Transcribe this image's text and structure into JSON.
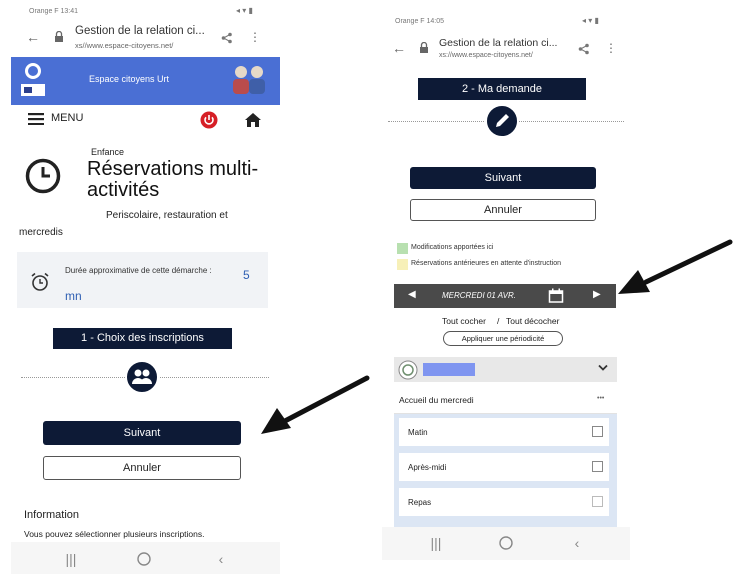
{
  "left": {
    "status_left": "Orange F 13:41",
    "status_right": "",
    "url_title": "Gestion de la relation ci...",
    "url_text": "xs//www.espace-citoyens.net/",
    "portal_name": "Espace citoyens Urt",
    "menu_label": "MENU",
    "category": "Enfance",
    "title_line1": "Réservations multi-",
    "title_line2": "activités",
    "subtitle_line1": "Periscolaire, restauration et",
    "subtitle_line2": "mercredis",
    "duration_label": "Durée approximative de cette démarche :",
    "duration_value": "5",
    "duration_unit": "mn",
    "step_label": "1 - Choix des inscriptions",
    "next_button": "Suivant",
    "cancel_button": "Annuler",
    "info_title": "Information",
    "info_text": "Vous pouvez sélectionner plusieurs inscriptions."
  },
  "right": {
    "status_left": "Orange F 14:05",
    "url_title": "Gestion de la relation ci...",
    "url_text": "xs://www.espace-citoyens.net/",
    "step_label": "2 - Ma demande",
    "next_button": "Suivant",
    "cancel_button": "Annuler",
    "legend_green": "Modifications apportées ici",
    "legend_yellow": "Réservations antérieures en attente d'instruction",
    "date_label": "MERCREDI 01 AVR.",
    "check_all": "Tout cocher",
    "separator": "/",
    "uncheck_all": "Tout décocher",
    "periodicity_button": "Appliquer une périodicité",
    "activity_title": "Accueil du mercredi",
    "activity_more": "•••",
    "slots": [
      "Matin",
      "Après-midi",
      "Repas"
    ]
  },
  "colors": {
    "navy": "#0d1a36",
    "header_blue": "#4a6fd4",
    "power_red": "#d61f26",
    "date_bar": "#4a4a4a",
    "legend_green": "#b8e0b0",
    "legend_yellow": "#f7f0b8",
    "slot_area_bg": "#dce6f4",
    "child_name_bar": "#7f95f0"
  },
  "icons": [
    "back-arrow-icon",
    "lock-icon",
    "share-icon",
    "more-vert-icon",
    "hamburger-icon",
    "power-icon",
    "home-icon",
    "clock-icon",
    "alarm-icon",
    "users-icon",
    "pencil-icon",
    "calendar-icon",
    "chevron-down-icon",
    "checkbox-icon",
    "recents-icon",
    "home-circle-icon",
    "back-nav-icon"
  ]
}
